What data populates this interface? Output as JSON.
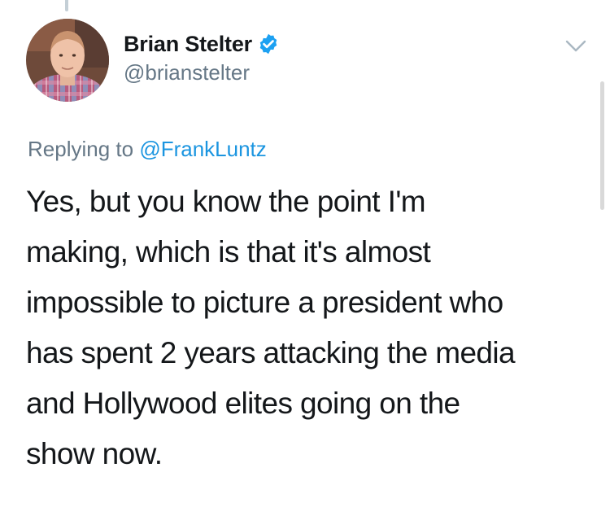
{
  "tweet": {
    "author": {
      "display_name": "Brian Stelter",
      "handle": "@brianstelter",
      "verified": true
    },
    "avatar_icon": "user-photo-avatar",
    "menu_icon": "chevron-down-icon",
    "replying": {
      "prefix": "Replying to",
      "mention": "@FrankLuntz"
    },
    "lines": [
      "Yes, but you know the point I'm",
      "making, which is that it's almost",
      "impossible to picture a president who",
      "has spent 2 years attacking the media",
      "and Hollywood elites going on the",
      "show now."
    ]
  },
  "colors": {
    "text": "#14171a",
    "secondary": "#657786",
    "link": "#1b95e0",
    "verified_badge": "#1da1f2"
  }
}
